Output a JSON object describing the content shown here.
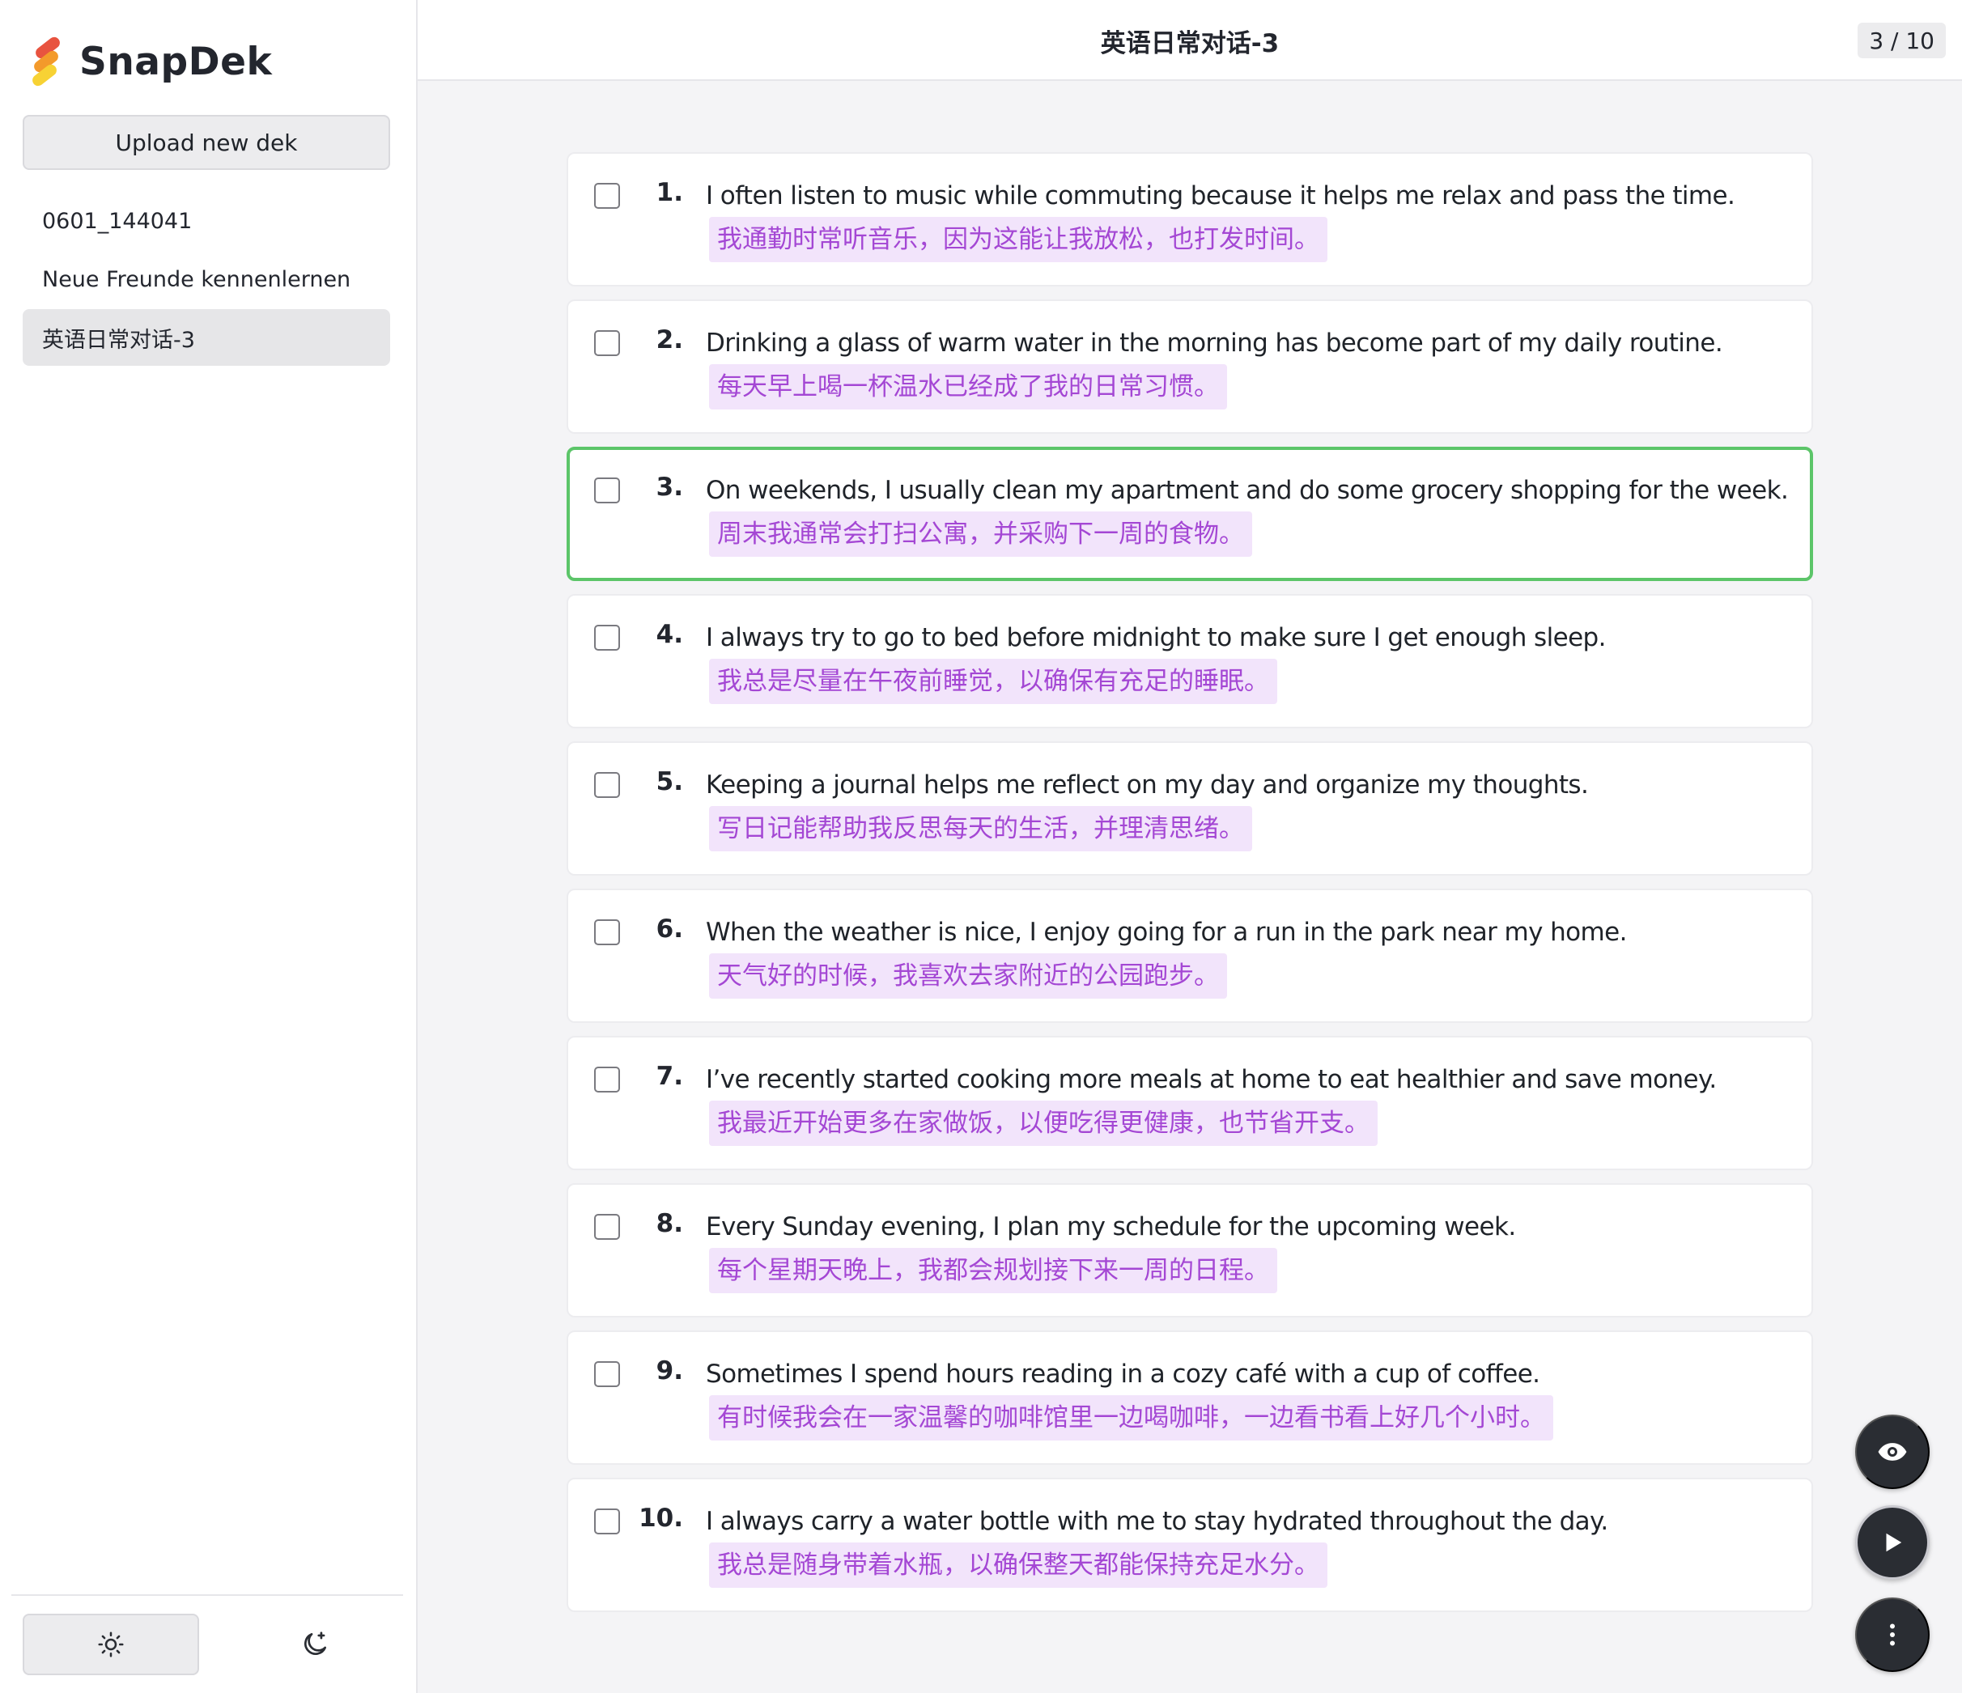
{
  "app": {
    "name": "SnapDek"
  },
  "sidebar": {
    "upload_label": "Upload new dek",
    "decks": [
      {
        "label": "0601_144041"
      },
      {
        "label": "Neue Freunde kennenlernen"
      },
      {
        "label": "英语日常对话-3",
        "active": true
      }
    ],
    "theme": {
      "light_icon": "sun-icon",
      "dark_icon": "moon-icon",
      "selected": "light"
    }
  },
  "header": {
    "title": "英语日常对话-3",
    "counter": "3 / 10"
  },
  "cards": [
    {
      "num": "1.",
      "en": "I often listen to music while commuting because it helps me relax and pass the time.",
      "zh": "我通勤时常听音乐，因为这能让我放松，也打发时间。"
    },
    {
      "num": "2.",
      "en": "Drinking a glass of warm water in the morning has become part of my daily routine.",
      "zh": "每天早上喝一杯温水已经成了我的日常习惯。"
    },
    {
      "num": "3.",
      "en": "On weekends, I usually clean my apartment and do some grocery shopping for the week.",
      "zh": "周末我通常会打扫公寓，并采购下一周的食物。",
      "active": true
    },
    {
      "num": "4.",
      "en": "I always try to go to bed before midnight to make sure I get enough sleep.",
      "zh": "我总是尽量在午夜前睡觉，以确保有充足的睡眠。"
    },
    {
      "num": "5.",
      "en": "Keeping a journal helps me reflect on my day and organize my thoughts.",
      "zh": "写日记能帮助我反思每天的生活，并理清思绪。"
    },
    {
      "num": "6.",
      "en": "When the weather is nice, I enjoy going for a run in the park near my home.",
      "zh": "天气好的时候，我喜欢去家附近的公园跑步。"
    },
    {
      "num": "7.",
      "en": "I’ve recently started cooking more meals at home to eat healthier and save money.",
      "zh": "我最近开始更多在家做饭，以便吃得更健康，也节省开支。"
    },
    {
      "num": "8.",
      "en": "Every Sunday evening, I plan my schedule for the upcoming week.",
      "zh": "每个星期天晚上，我都会规划接下来一周的日程。"
    },
    {
      "num": "9.",
      "en": "Sometimes I spend hours reading in a cozy café with a cup of coffee.",
      "zh": "有时候我会在一家温馨的咖啡馆里一边喝咖啡，一边看书看上好几个小时。"
    },
    {
      "num": "10.",
      "en": "I always carry a water bottle with me to stay hydrated throughout the day.",
      "zh": "我总是随身带着水瓶，以确保整天都能保持充足水分。"
    }
  ],
  "floating_actions": [
    {
      "icon": "eye-icon"
    },
    {
      "icon": "play-icon"
    },
    {
      "icon": "more-vertical-icon"
    }
  ],
  "colors": {
    "accent_active_border": "#5cc569",
    "translation_text": "#a447d4",
    "translation_bg": "#f2e4fb",
    "fab_bg": "#2a2d33"
  }
}
